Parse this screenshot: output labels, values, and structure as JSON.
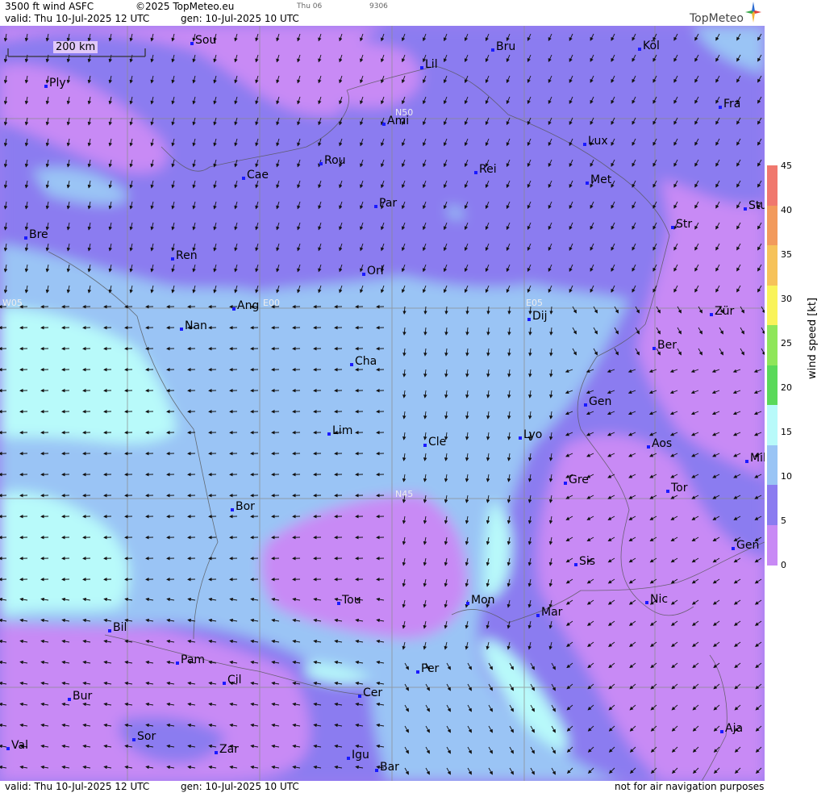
{
  "header": {
    "title": "3500 ft wind ASFC",
    "copyright": "©2025 TopMeteo.eu",
    "valid": "valid:  Thu  10-Jul-2025  12 UTC",
    "gen": "gen: 10-Jul-2025 10 UTC",
    "small1": "Thu 06",
    "small2": "9306",
    "brand": "TopMeteo"
  },
  "footer": {
    "valid": "valid:  Thu  10-Jul-2025  12 UTC",
    "gen": "gen: 10-Jul-2025 10 UTC",
    "disclaimer": "not for air navigation purposes"
  },
  "map": {
    "scale_label": "200 km",
    "grid_labels": {
      "n50": "N50",
      "n45": "N45",
      "w05": "W05",
      "e00": "E00",
      "e05": "E05"
    },
    "cities": [
      {
        "name": "Sou"
      },
      {
        "name": "Bru"
      },
      {
        "name": "Köl"
      },
      {
        "name": "Lil"
      },
      {
        "name": "Ply"
      },
      {
        "name": "Fra"
      },
      {
        "name": "Ami"
      },
      {
        "name": "Lux"
      },
      {
        "name": "Rou"
      },
      {
        "name": "Rei"
      },
      {
        "name": "Cae"
      },
      {
        "name": "Met"
      },
      {
        "name": "Par"
      },
      {
        "name": "Stu"
      },
      {
        "name": "Str"
      },
      {
        "name": "Bre"
      },
      {
        "name": "Ren"
      },
      {
        "name": "Orl"
      },
      {
        "name": "Ang"
      },
      {
        "name": "Dij"
      },
      {
        "name": "Zür"
      },
      {
        "name": "Nan"
      },
      {
        "name": "Ber"
      },
      {
        "name": "Cha"
      },
      {
        "name": "Gen"
      },
      {
        "name": "Lim"
      },
      {
        "name": "Cle"
      },
      {
        "name": "Lyo"
      },
      {
        "name": "Aos"
      },
      {
        "name": "Mil"
      },
      {
        "name": "Gre"
      },
      {
        "name": "Tor"
      },
      {
        "name": "Bor"
      },
      {
        "name": "Gen"
      },
      {
        "name": "Sis"
      },
      {
        "name": "Tou"
      },
      {
        "name": "Mon"
      },
      {
        "name": "Mar"
      },
      {
        "name": "Nic"
      },
      {
        "name": "Bil"
      },
      {
        "name": "Pam"
      },
      {
        "name": "Per"
      },
      {
        "name": "Cil"
      },
      {
        "name": "Cer"
      },
      {
        "name": "Bur"
      },
      {
        "name": "Sor"
      },
      {
        "name": "Aja"
      },
      {
        "name": "Val"
      },
      {
        "name": "Zar"
      },
      {
        "name": "Igu"
      },
      {
        "name": "Bar"
      }
    ]
  },
  "legend": {
    "title": "wind  speed  [kt]",
    "ticks": [
      "45",
      "40",
      "35",
      "30",
      "25",
      "20",
      "15",
      "10",
      "5",
      "0"
    ],
    "colors": [
      "#f0786e",
      "#f29a5c",
      "#f6c25a",
      "#f9f35a",
      "#8fe65a",
      "#5ad95a",
      "#b8fafa",
      "#9ac4f5",
      "#8b7bf0",
      "#c88af5"
    ]
  }
}
